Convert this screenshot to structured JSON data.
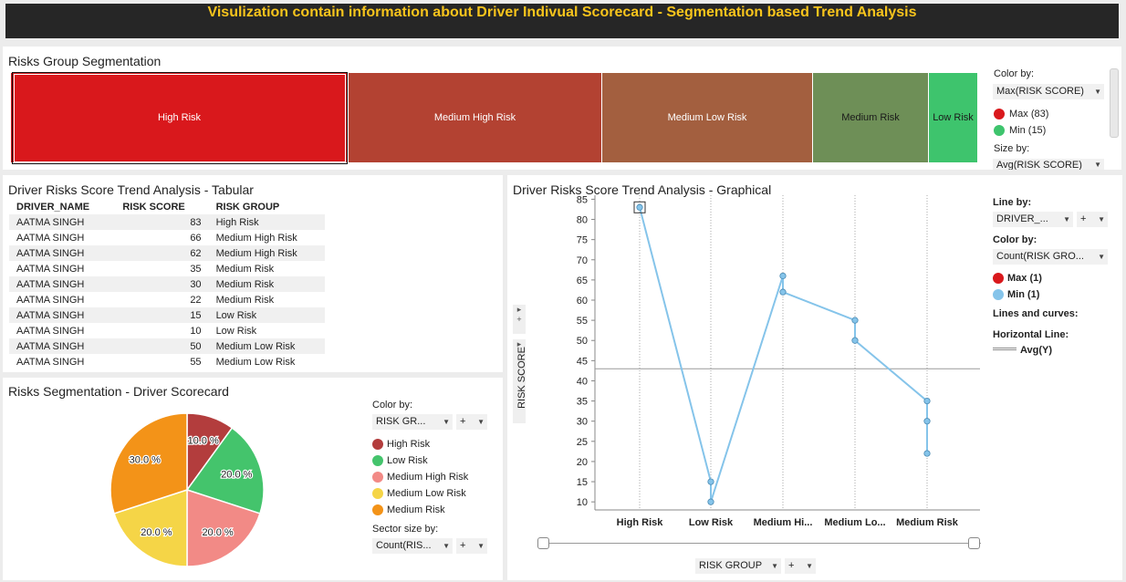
{
  "header": {
    "title": "Visulization contain information about Driver Indivual Scorecard - Segmentation based Trend Analysis"
  },
  "colors": {
    "title_text": "#f7c41c",
    "title_bg": "#262626",
    "high_risk": "#d9181c",
    "medium_high_risk": "#b34232",
    "medium_low_risk": "#a35f3f",
    "medium_risk": "#6e8f57",
    "low_risk": "#3ec46d",
    "line": "#85c4ea",
    "pie_high": "#b33d3d",
    "pie_low": "#44c46c",
    "pie_med_high": "#f28a86",
    "pie_med_low": "#f5d547",
    "pie_med": "#f39318"
  },
  "treemap": {
    "title": "Risks Group Segmentation",
    "cells": [
      {
        "label": "High Risk",
        "color": "#d9181c",
        "value": 83
      },
      {
        "label": "Medium High Risk",
        "color": "#b34232",
        "value": 66
      },
      {
        "label": "Medium Low Risk",
        "color": "#a35f3f",
        "value": 55
      },
      {
        "label": "Medium Risk",
        "color": "#6e8f57",
        "value": 35
      },
      {
        "label": "Low Risk",
        "color": "#3ec46d",
        "value": 15
      }
    ],
    "legend": {
      "color_by_label": "Color by:",
      "color_by_value": "Max(RISK SCORE)",
      "max_label": "Max (83)",
      "min_label": "Min (15)",
      "size_by_label": "Size by:",
      "size_by_value": "Avg(RISK SCORE)"
    }
  },
  "table": {
    "title": "Driver Risks Score Trend Analysis - Tabular",
    "columns": [
      "DRIVER_NAME",
      "RISK SCORE",
      "RISK GROUP"
    ],
    "rows": [
      [
        "AATMA SINGH",
        "83",
        "High Risk"
      ],
      [
        "AATMA SINGH",
        "66",
        "Medium High Risk"
      ],
      [
        "AATMA SINGH",
        "62",
        "Medium High Risk"
      ],
      [
        "AATMA SINGH",
        "35",
        "Medium Risk"
      ],
      [
        "AATMA SINGH",
        "30",
        "Medium Risk"
      ],
      [
        "AATMA SINGH",
        "22",
        "Medium Risk"
      ],
      [
        "AATMA SINGH",
        "15",
        "Low Risk"
      ],
      [
        "AATMA SINGH",
        "10",
        "Low Risk"
      ],
      [
        "AATMA SINGH",
        "50",
        "Medium Low Risk"
      ],
      [
        "AATMA SINGH",
        "55",
        "Medium Low Risk"
      ]
    ]
  },
  "pie": {
    "title": "Risks Segmentation - Driver Scorecard",
    "legend": {
      "color_by_label": "Color by:",
      "color_by_value": "RISK GR...",
      "plus": "+",
      "items": [
        "High Risk",
        "Low Risk",
        "Medium High Risk",
        "Medium Low Risk",
        "Medium Risk"
      ],
      "sector_label": "Sector size by:",
      "sector_value": "Count(RIS..."
    }
  },
  "line_panel": {
    "title": "Driver Risks Score Trend Analysis - Graphical",
    "legend": {
      "line_by_label": "Line by:",
      "line_by_value": "DRIVER_...",
      "color_by_label": "Color by:",
      "color_by_value": "Count(RISK GRO...",
      "max_label": "Max (1)",
      "min_label": "Min (1)",
      "lines_curves": "Lines and curves:",
      "horizontal_line": "Horizontal Line:",
      "avg_label": "Avg(Y)"
    },
    "x_axis_selector": "RISK GROUP",
    "plus": "+"
  },
  "chart_data": [
    {
      "type": "bar",
      "title": "Risks Group Segmentation",
      "categories": [
        "High Risk",
        "Medium High Risk",
        "Medium Low Risk",
        "Medium Risk",
        "Low Risk"
      ],
      "values": [
        83,
        66,
        55,
        35,
        15
      ]
    },
    {
      "type": "pie",
      "title": "Risks Segmentation - Driver Scorecard",
      "slices": [
        {
          "label": "High Risk",
          "percent": 10.0,
          "text": "10.0 %",
          "color": "#b33d3d"
        },
        {
          "label": "Low Risk",
          "percent": 20.0,
          "text": "20.0 %",
          "color": "#44c46c"
        },
        {
          "label": "Medium High Risk",
          "percent": 20.0,
          "text": "20.0 %",
          "color": "#f28a86"
        },
        {
          "label": "Medium Low Risk",
          "percent": 20.0,
          "text": "20.0 %",
          "color": "#f5d547"
        },
        {
          "label": "Medium Risk",
          "percent": 30.0,
          "text": "30.0 %",
          "color": "#f39318"
        }
      ]
    },
    {
      "type": "line",
      "title": "Driver Risks Score Trend Analysis - Graphical",
      "xlabel": "",
      "ylabel": "RISK SCORE",
      "categories": [
        "High Risk",
        "Low Risk",
        "Medium Hi...",
        "Medium Lo...",
        "Medium Risk"
      ],
      "ylim": [
        8,
        86
      ],
      "yticks": [
        10,
        15,
        20,
        25,
        30,
        35,
        40,
        45,
        50,
        55,
        60,
        65,
        70,
        75,
        80,
        85
      ],
      "reference_line": {
        "y": 43
      },
      "points": [
        {
          "category": 0,
          "y": 83
        },
        {
          "category": 1,
          "y": 15
        },
        {
          "category": 1,
          "y": 10
        },
        {
          "category": 2,
          "y": 66
        },
        {
          "category": 2,
          "y": 62
        },
        {
          "category": 3,
          "y": 55
        },
        {
          "category": 3,
          "y": 50
        },
        {
          "category": 4,
          "y": 35
        },
        {
          "category": 4,
          "y": 30
        },
        {
          "category": 4,
          "y": 22
        }
      ]
    }
  ]
}
